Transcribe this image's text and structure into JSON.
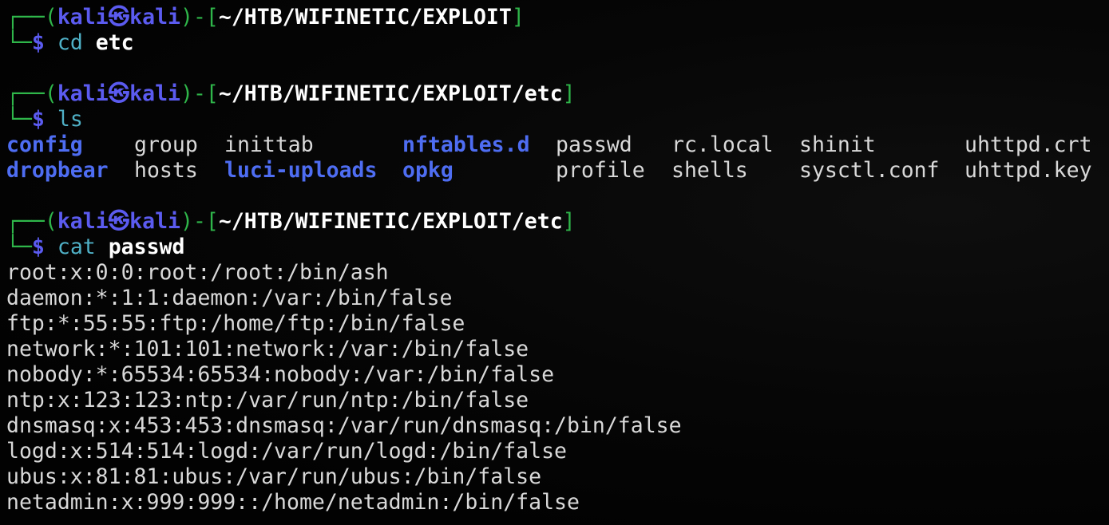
{
  "prompts": [
    {
      "corner": "┌──",
      "open": "(",
      "user": "kali",
      "at": "㉿",
      "host": "kali",
      "mid": ")-[",
      "path": "~/HTB/WIFINETIC/EXPLOIT",
      "close": "]",
      "branch": "└─",
      "dollar": "$",
      "command": "cd",
      "argument": "etc"
    },
    {
      "corner": "┌──",
      "open": "(",
      "user": "kali",
      "at": "㉿",
      "host": "kali",
      "mid": ")-[",
      "path": "~/HTB/WIFINETIC/EXPLOIT/etc",
      "close": "]",
      "branch": "└─",
      "dollar": "$",
      "command": "ls",
      "argument": ""
    },
    {
      "corner": "┌──",
      "open": "(",
      "user": "kali",
      "at": "㉿",
      "host": "kali",
      "mid": ")-[",
      "path": "~/HTB/WIFINETIC/EXPLOIT/etc",
      "close": "]",
      "branch": "└─",
      "dollar": "$",
      "command": "cat",
      "argument": "passwd"
    }
  ],
  "ls_output": {
    "row1": [
      {
        "name": "config",
        "type": "dir"
      },
      {
        "name": "group",
        "type": "file"
      },
      {
        "name": "inittab",
        "type": "file"
      },
      {
        "name": "nftables.d",
        "type": "dir"
      },
      {
        "name": "passwd",
        "type": "file"
      },
      {
        "name": "rc.local",
        "type": "file"
      },
      {
        "name": "shinit",
        "type": "file"
      },
      {
        "name": "uhttpd.crt",
        "type": "file"
      }
    ],
    "row2": [
      {
        "name": "dropbear",
        "type": "dir"
      },
      {
        "name": "hosts",
        "type": "file"
      },
      {
        "name": "luci-uploads",
        "type": "dir"
      },
      {
        "name": "opkg",
        "type": "dir"
      },
      {
        "name": "profile",
        "type": "file"
      },
      {
        "name": "shells",
        "type": "file"
      },
      {
        "name": "sysctl.conf",
        "type": "file"
      },
      {
        "name": "uhttpd.key",
        "type": "file"
      }
    ]
  },
  "passwd_lines": [
    "root:x:0:0:root:/root:/bin/ash",
    "daemon:*:1:1:daemon:/var:/bin/false",
    "ftp:*:55:55:ftp:/home/ftp:/bin/false",
    "network:*:101:101:network:/var:/bin/false",
    "nobody:*:65534:65534:nobody:/var:/bin/false",
    "ntp:x:123:123:ntp:/var/run/ntp:/bin/false",
    "dnsmasq:x:453:453:dnsmasq:/var/run/dnsmasq:/bin/false",
    "logd:x:514:514:logd:/var/run/logd:/bin/false",
    "ubus:x:81:81:ubus:/var/run/ubus:/bin/false",
    "netadmin:x:999:999::/home/netadmin:/bin/false"
  ],
  "colors": {
    "background": "#000000",
    "prompt_frame": "#2fb64a",
    "user_host": "#5b5bf0",
    "command": "#4fb0c6",
    "directory": "#4e6df2",
    "text": "#d9d9d9"
  }
}
